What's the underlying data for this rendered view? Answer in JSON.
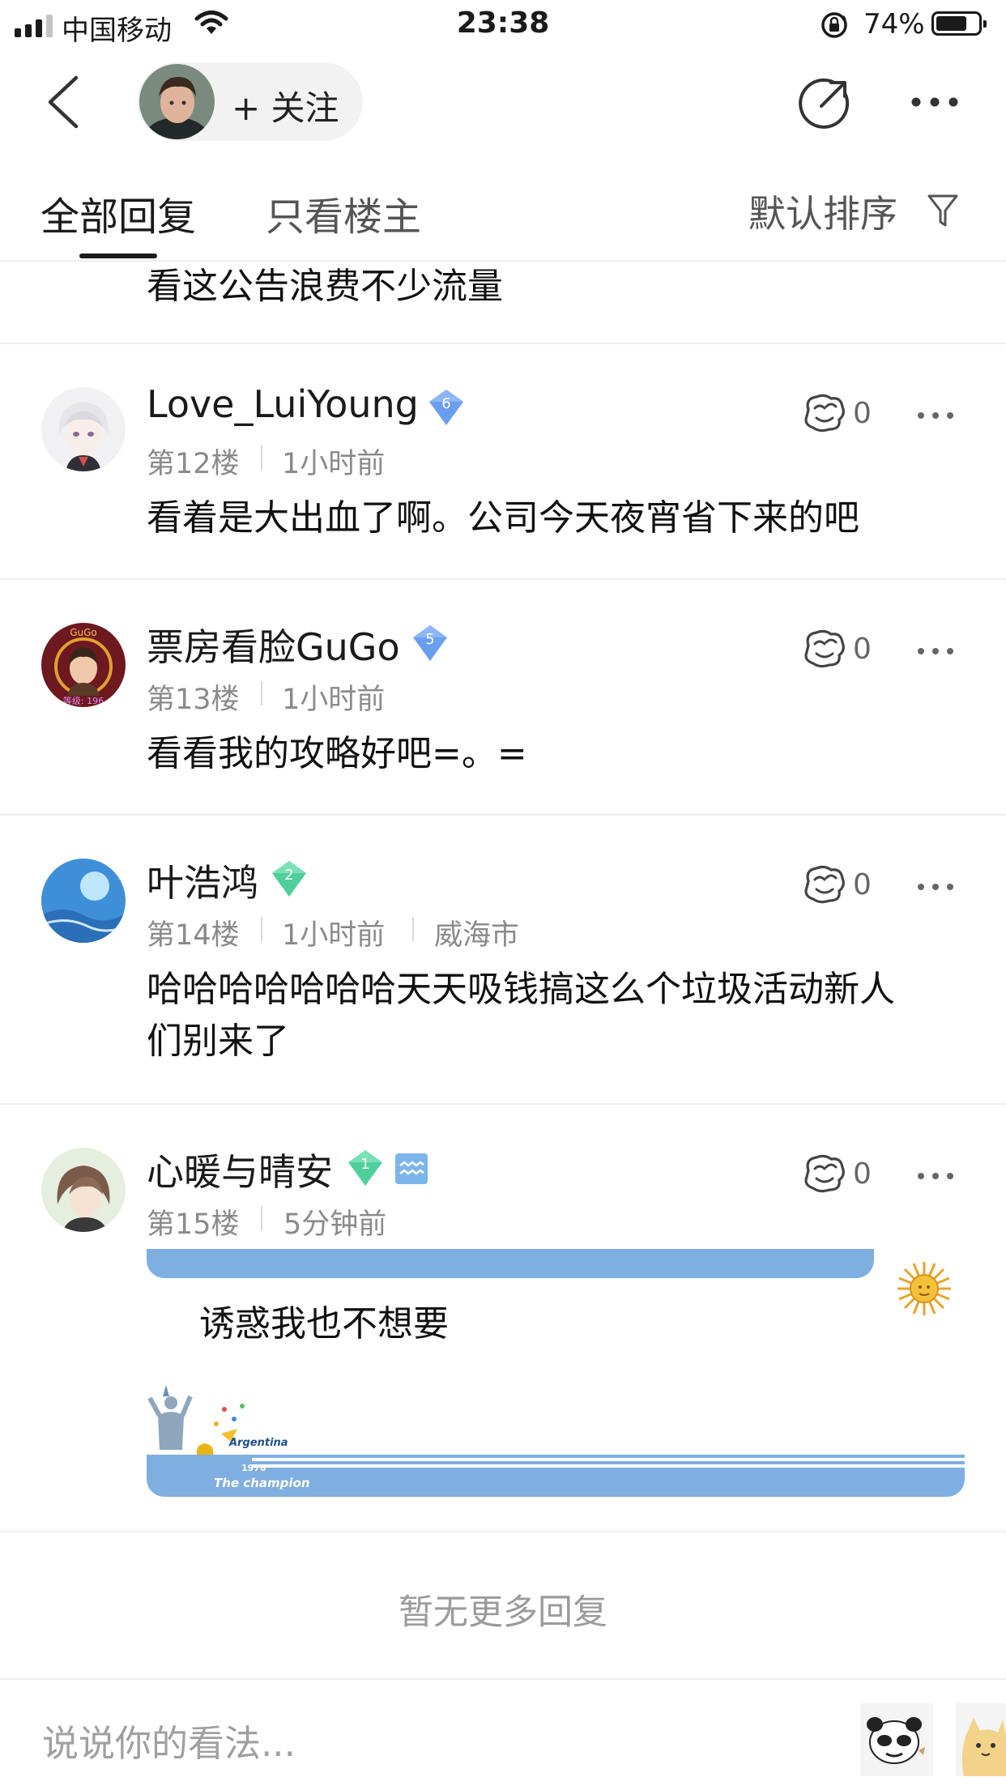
{
  "status_bar": {
    "carrier": "中国移动",
    "time": "23:38",
    "battery_percent": "74%",
    "battery_level": 0.74
  },
  "nav": {
    "follow_label": "+ 关注"
  },
  "tabs": {
    "all": "全部回复",
    "owner_only": "只看楼主",
    "sort": "默认排序"
  },
  "partial_comment": "看这公告浪费不少流量",
  "comments": [
    {
      "username": "Love_LuiYoung",
      "level": "6",
      "floor": "第12楼",
      "time": "1小时前",
      "location": "",
      "likes": "0",
      "text": "看着是大出血了啊。公司今天夜宵省下来的吧"
    },
    {
      "username": "票房看脸GuGo",
      "level": "5",
      "floor": "第13楼",
      "time": "1小时前",
      "location": "",
      "likes": "0",
      "text": "看看我的攻略好吧=。="
    },
    {
      "username": "叶浩鸿",
      "level": "2",
      "floor": "第14楼",
      "time": "1小时前",
      "location": "威海市",
      "likes": "0",
      "text_line1": "哈哈哈哈哈哈哈天天吸钱搞这么个垃圾活动新人",
      "text_line2": "们别来了"
    },
    {
      "username": "心暖与晴安",
      "level": "1",
      "floor": "第15楼",
      "time": "5分钟前",
      "location": "",
      "likes": "0",
      "text": "诱惑我也不想要"
    }
  ],
  "avatar_texts": {
    "gugo_top": "GuGo",
    "gugo_bottom": "等级: 196"
  },
  "tail_card": {
    "title": "Argentina",
    "year": "1978",
    "caption": "The champion"
  },
  "no_more": "暂无更多回复",
  "input_placeholder": "说说你的看法..."
}
